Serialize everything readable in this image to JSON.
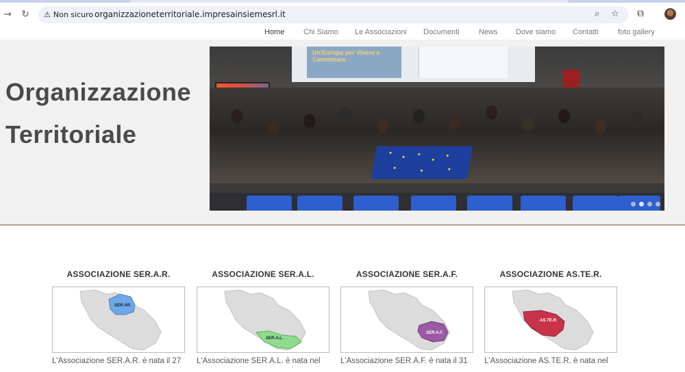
{
  "browser": {
    "back_icon": "arrow-right-icon",
    "reload_icon": "reload-icon",
    "security_label": "Non sicuro",
    "url": "organizzazioneterritoriale.impresainsiemesrl.it",
    "zoom_icon": "magnifier-icon",
    "bookmark_icon": "star-icon",
    "extensions_icon": "puzzle-icon"
  },
  "nav": {
    "items": [
      {
        "label": "Home"
      },
      {
        "label": "Chi Siamo"
      },
      {
        "label": "Le Associazioni"
      },
      {
        "label": "Documenti"
      },
      {
        "label": "News"
      },
      {
        "label": "Dove siamo"
      },
      {
        "label": "Contatti"
      },
      {
        "label": "foto gallery"
      }
    ]
  },
  "hero": {
    "title_line1": "Organizzazione",
    "title_line2": "Territoriale",
    "slide_screen_text": "Un'Europa per Vivere e Camminare",
    "slide_count": 4,
    "active_slide": 1
  },
  "associations": [
    {
      "title": "ASSOCIAZIONE SER.A.R.",
      "map_label": "SER.AR.",
      "highlight": "#6fa8e6",
      "text": "L'Associazione SER.A.R. è nata il 27"
    },
    {
      "title": "ASSOCIAZIONE SER.A.L.",
      "map_label": "SER.A.L.",
      "highlight": "#8fdc8f",
      "text": "L'Associazione SER.A.L. è nata nel"
    },
    {
      "title": "ASSOCIAZIONE SER.A.F.",
      "map_label": "SER.A.F.",
      "highlight": "#9c5aa5",
      "text": "L'Associazione SER.A.F. è nata il 31"
    },
    {
      "title": "ASSOCIAZIONE AS.TE.R.",
      "map_label": "AS.TE.R.",
      "highlight": "#c8334a",
      "text": "L'Associazione AS.TE.R. è nata nel"
    }
  ]
}
